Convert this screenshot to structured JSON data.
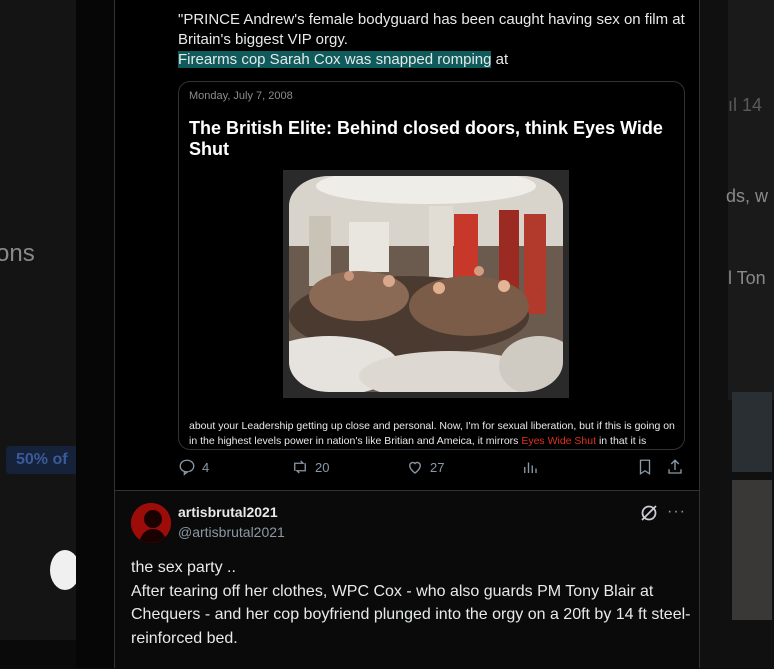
{
  "background": {
    "left_fragment": "ons",
    "left_badge": "50% of",
    "right_fragments": [
      "ıl 14",
      "ds, w",
      "l Ton"
    ]
  },
  "quote": {
    "line1": "\"PRINCE Andrew's female bodyguard has been caught having sex on film at Britain's biggest VIP orgy.",
    "highlighted": "Firearms cop Sarah Cox was snapped romping",
    "line2_end": " at"
  },
  "card": {
    "date": "Monday, July 7, 2008",
    "title": "The British Elite: Behind closed doors, think Eyes Wide Shut",
    "body_before": "about your Leadership getting up close and personal. Now, I'm for sexual liberation, but if this is going on in the highest levels power in nation's like Britian and Ameica, it mirrors ",
    "body_link": "Eyes Wide Shut",
    "body_after": " in that it is"
  },
  "actions": {
    "replies": "4",
    "reposts": "20",
    "likes": "27"
  },
  "reply": {
    "name": "artisbrutal2021",
    "handle": "@artisbrutal2021",
    "line1": "the sex party ..",
    "line2": "After tearing off her clothes, WPC Cox - who also guards PM Tony Blair at Chequers - and her cop boyfriend plunged into the orgy on a 20ft by 14 ft steel-reinforced bed."
  },
  "colors": {
    "highlight": "#0f5a5a",
    "link_red": "#e0301e",
    "muted": "#8b98a5"
  }
}
